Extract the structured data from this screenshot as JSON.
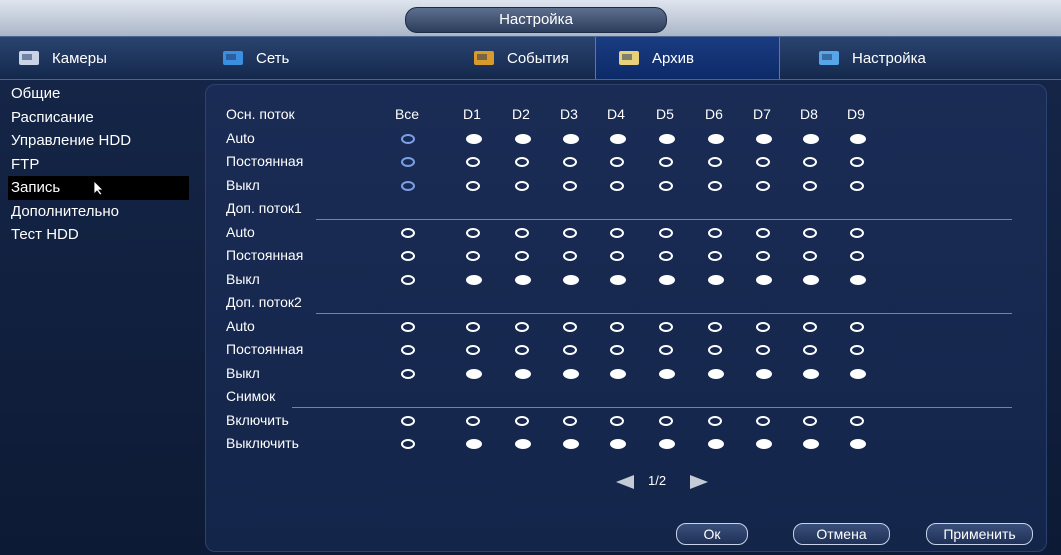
{
  "window": {
    "title": "Настройка"
  },
  "tabs": [
    {
      "label": "Камеры",
      "icon": "camera-icon"
    },
    {
      "label": "Сеть",
      "icon": "network-icon"
    },
    {
      "label": "События",
      "icon": "events-icon"
    },
    {
      "label": "Архив",
      "icon": "archive-icon"
    },
    {
      "label": "Настройка",
      "icon": "settings-icon"
    }
  ],
  "sidebar": {
    "items": [
      {
        "label": "Общие"
      },
      {
        "label": "Расписание"
      },
      {
        "label": "Управление HDD"
      },
      {
        "label": "FTP"
      },
      {
        "label": "Запись"
      },
      {
        "label": "Дополнительно"
      },
      {
        "label": "Тест HDD"
      }
    ],
    "active_index": 4
  },
  "grid": {
    "main_label": "Осн. поток",
    "columns": [
      "Все",
      "D1",
      "D2",
      "D3",
      "D4",
      "D5",
      "D6",
      "D7",
      "D8",
      "D9"
    ],
    "sections": [
      {
        "title": "",
        "rows": [
          {
            "label": "Auto",
            "selected": true
          },
          {
            "label": "Постоянная",
            "selected": false
          },
          {
            "label": "Выкл",
            "selected": false
          }
        ]
      },
      {
        "title": "Доп. поток1",
        "rows": [
          {
            "label": "Auto",
            "selected": false
          },
          {
            "label": "Постоянная",
            "selected": false
          },
          {
            "label": "Выкл",
            "selected": true
          }
        ]
      },
      {
        "title": "Доп. поток2",
        "rows": [
          {
            "label": "Auto",
            "selected": false
          },
          {
            "label": "Постоянная",
            "selected": false
          },
          {
            "label": "Выкл",
            "selected": true
          }
        ]
      },
      {
        "title": "Снимок",
        "rows": [
          {
            "label": "Включить",
            "selected": false
          },
          {
            "label": "Выключить",
            "selected": true
          }
        ]
      }
    ]
  },
  "pager": {
    "text": "1/2"
  },
  "buttons": {
    "ok": "Ок",
    "cancel": "Отмена",
    "apply": "Применить"
  }
}
